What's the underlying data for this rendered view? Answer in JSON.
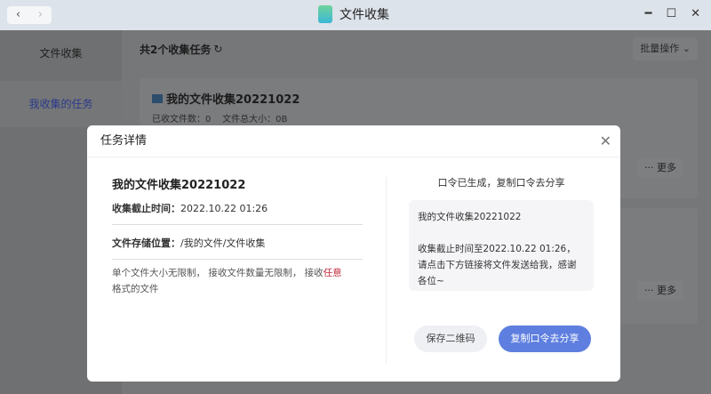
{
  "window": {
    "title": "文件收集",
    "back": "‹",
    "forward": "›",
    "minimize": "━",
    "maximize": "☐",
    "close": "✕"
  },
  "sidebar": {
    "items": [
      {
        "label": "文件收集"
      },
      {
        "label": "我收集的任务"
      }
    ]
  },
  "main": {
    "header": "共2个收集任务",
    "refresh": "↻",
    "batch": "批量操作",
    "batch_caret": "⌄",
    "card": {
      "title": "我的文件收集20221022",
      "received": "已收文件数：0",
      "size": "文件总大小：0B"
    },
    "more_label": "··· 更多"
  },
  "modal": {
    "title": "任务详情",
    "close": "✕",
    "name": "我的文件收集20221022",
    "deadline_label": "收集截止时间：",
    "deadline": "2022.10.22 01:26",
    "location_label": "文件存储位置：",
    "location": "/我的文件/文件收集",
    "note_prefix": "单个文件大小无限制， 接收文件数量无限制， 接收",
    "note_highlight": "任意",
    "note_suffix": "格式的文件",
    "share_title": "口令已生成，复制口令去分享",
    "share_line1": "我的文件收集20221022",
    "share_line2": "收集截止时间至2022.10.22 01:26， 请点击下方链接将文件发送给我，感谢各位~",
    "save_qr": "保存二维码",
    "copy": "复制口令去分享"
  },
  "colors": {
    "accent": "#5e7fdf",
    "highlight": "#c0283a"
  }
}
